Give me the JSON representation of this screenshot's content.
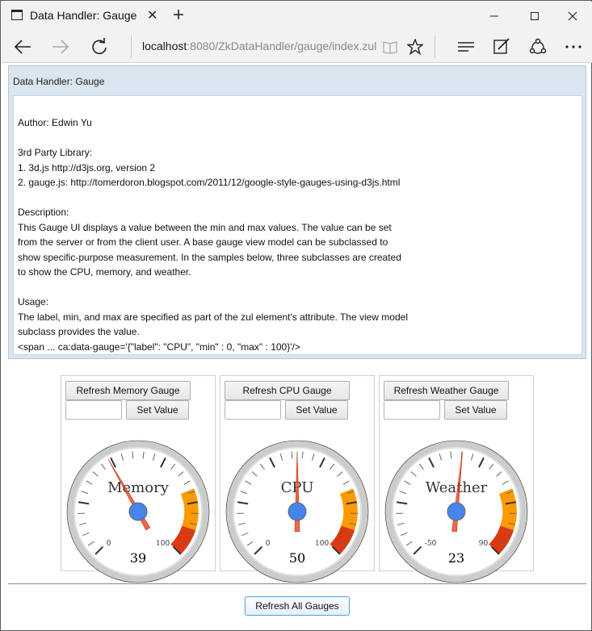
{
  "browser": {
    "tab_title": "Data Handler: Gauge",
    "url_host": "localhost",
    "url_rest": ":8080/ZkDataHandler/gauge/index.zul"
  },
  "panel": {
    "title": "Data Handler: Gauge",
    "lines": [
      "Author: Edwin Yu",
      "",
      "3rd Party Library:",
      "1. 3d.js http://d3js.org, version 2",
      "2. gauge.js: http://tomerdoron.blogspot.com/2011/12/google-style-gauges-using-d3js.html",
      "",
      "Description:",
      "This Gauge UI displays a value between the min and max values. The value can be set",
      "from the server or from the client user. A base gauge view model can be subclassed to",
      "show specific-purpose measurement. In the samples below, three subclasses are created",
      "to show the CPU, memory, and weather.",
      "",
      "Usage:",
      "The label, min, and max are specified as part of the zul element's attribute. The view model",
      "subclass provides the value.",
      "<span ... ca:data-gauge='{\"label\": \"CPU\", \"min\" : 0, \"max\" : 100}'/>"
    ]
  },
  "gauges": [
    {
      "refresh_label": "Refresh Memory Gauge",
      "set_label": "Set Value",
      "input_value": "",
      "label": "Memory",
      "min": 0,
      "max": 100,
      "value": 39,
      "min_text": "0",
      "max_text": "100",
      "value_text": "39"
    },
    {
      "refresh_label": "Refresh CPU Gauge",
      "set_label": "Set Value",
      "input_value": "",
      "label": "CPU",
      "min": 0,
      "max": 100,
      "value": 50,
      "min_text": "0",
      "max_text": "100",
      "value_text": "50"
    },
    {
      "refresh_label": "Refresh Weather Gauge",
      "set_label": "Set Value",
      "input_value": "",
      "label": "Weather",
      "min": -50,
      "max": 90,
      "value": 23,
      "min_text": "-50",
      "max_text": "90",
      "value_text": "23"
    }
  ],
  "colors": {
    "yellow_zone": "#ff9900",
    "red_zone": "#dc3912",
    "needle": "#dc3912",
    "center": "#4684ee"
  },
  "refresh_all_label": "Refresh All Gauges"
}
